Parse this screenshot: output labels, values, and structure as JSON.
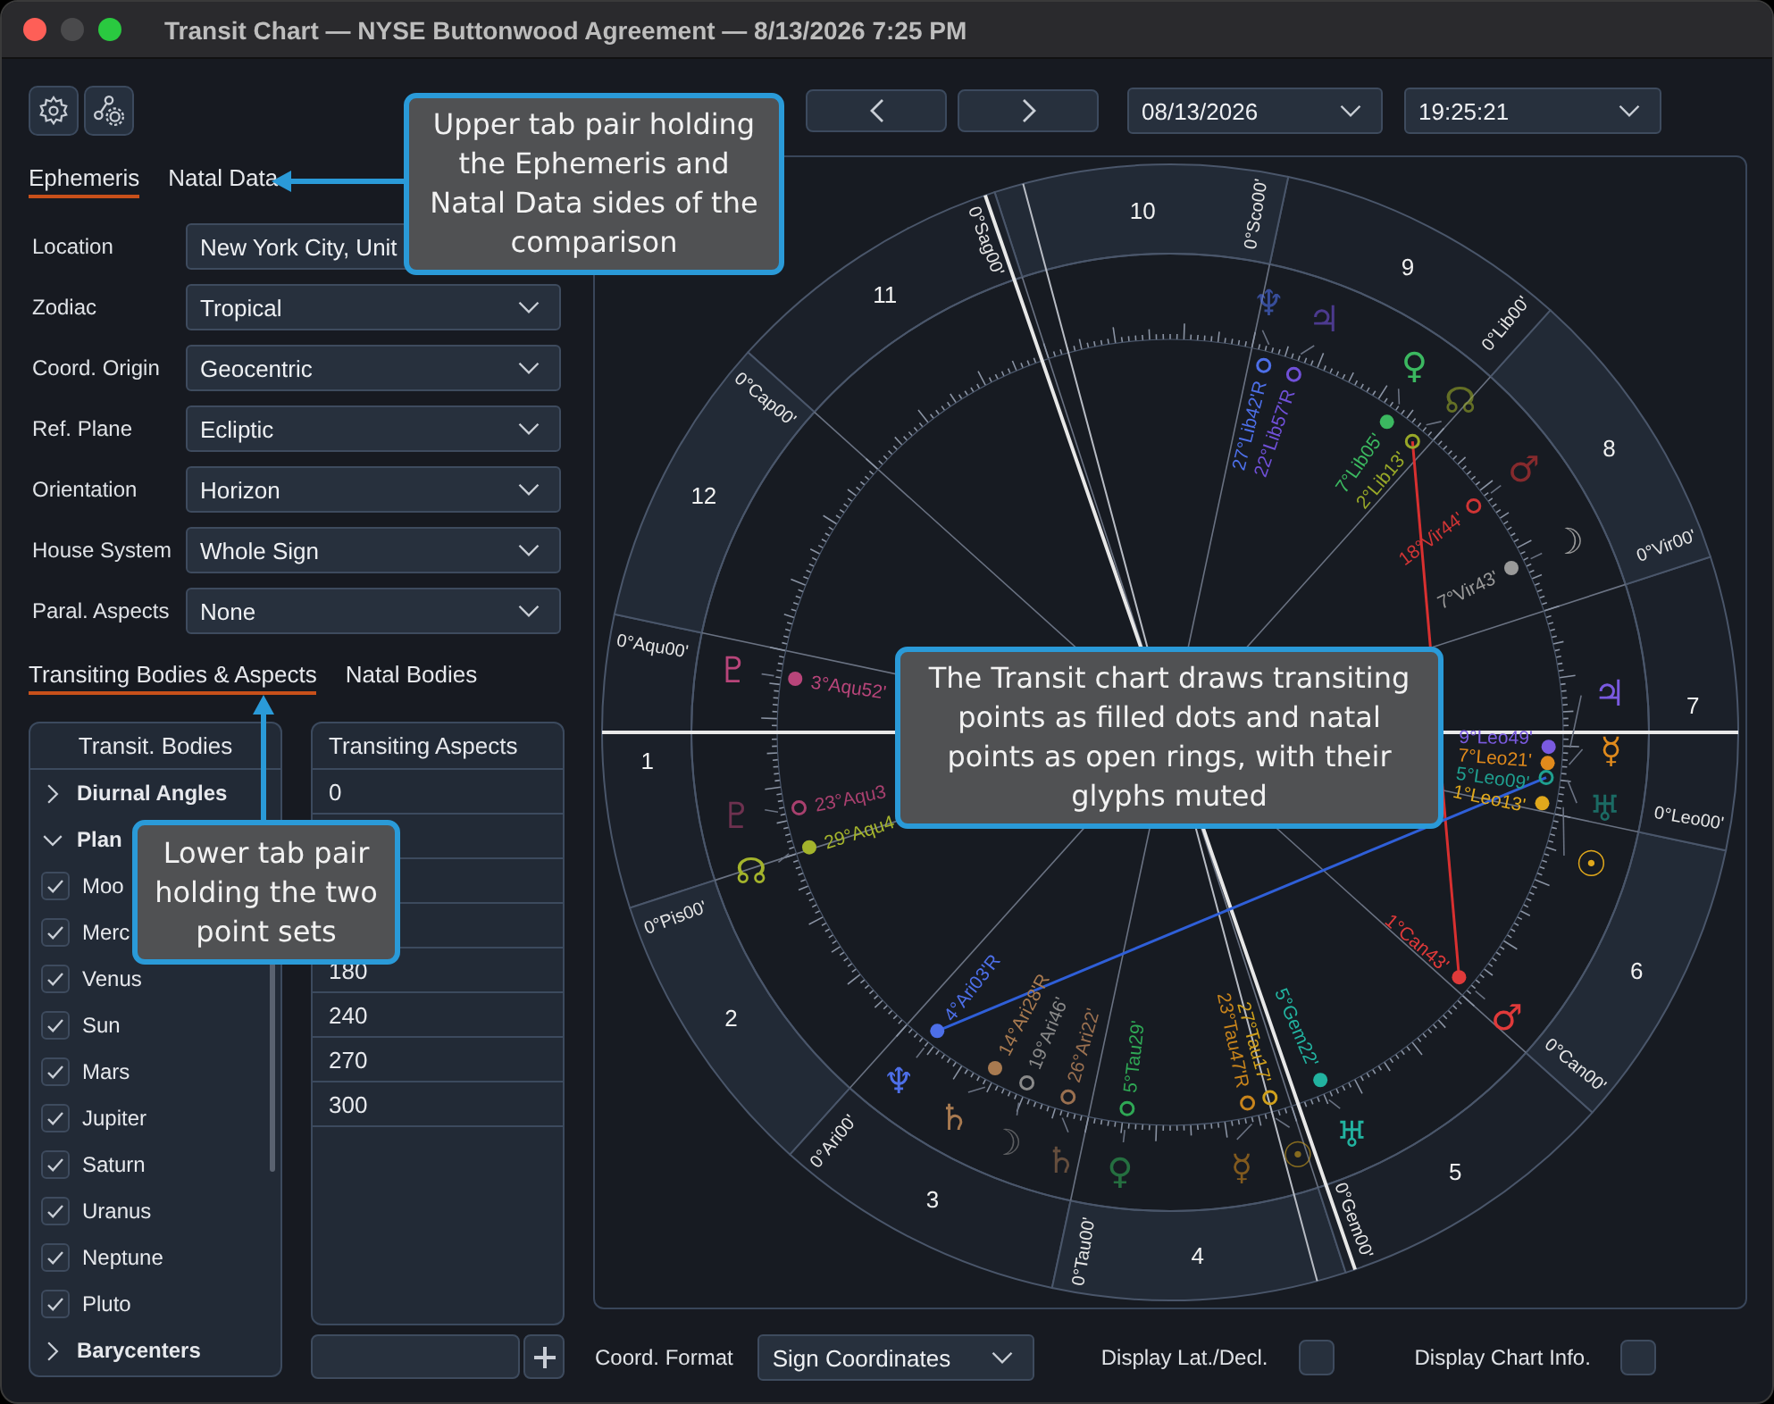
{
  "window": {
    "title": "Transit Chart — NYSE Buttonwood Agreement — 8/13/2026 7:25 PM"
  },
  "toolbar": {
    "date": "08/13/2026",
    "time": "19:25:21"
  },
  "upper_tabs": [
    {
      "label": "Ephemeris",
      "selected": true
    },
    {
      "label": "Natal Data",
      "selected": false
    }
  ],
  "fields": [
    {
      "label": "Location",
      "value": "New York City, Unit",
      "kind": "text"
    },
    {
      "label": "Zodiac",
      "value": "Tropical",
      "kind": "select"
    },
    {
      "label": "Coord. Origin",
      "value": "Geocentric",
      "kind": "select"
    },
    {
      "label": "Ref. Plane",
      "value": "Ecliptic",
      "kind": "select"
    },
    {
      "label": "Orientation",
      "value": "Horizon",
      "kind": "select"
    },
    {
      "label": "House System",
      "value": "Whole Sign",
      "kind": "select"
    },
    {
      "label": "Paral. Aspects",
      "value": "None",
      "kind": "select"
    }
  ],
  "lower_tabs": [
    {
      "label": "Transiting Bodies & Aspects",
      "selected": true
    },
    {
      "label": "Natal Bodies",
      "selected": false
    }
  ],
  "bodies": {
    "header": "Transit. Bodies",
    "groups": [
      {
        "label": "Diurnal Angles",
        "expanded": false
      },
      {
        "label": "Plan",
        "expanded": true,
        "children": [
          {
            "label": "Moo",
            "checked": true
          },
          {
            "label": "Merc",
            "checked": true
          },
          {
            "label": "Venus",
            "checked": true
          },
          {
            "label": "Sun",
            "checked": true
          },
          {
            "label": "Mars",
            "checked": true
          },
          {
            "label": "Jupiter",
            "checked": true
          },
          {
            "label": "Saturn",
            "checked": true
          },
          {
            "label": "Uranus",
            "checked": true
          },
          {
            "label": "Neptune",
            "checked": true
          },
          {
            "label": "Pluto",
            "checked": true
          }
        ]
      },
      {
        "label": "Barycenters",
        "expanded": false
      }
    ]
  },
  "aspects": {
    "header": "Transiting Aspects",
    "rows": [
      "0",
      null,
      null,
      null,
      "180",
      "240",
      "270",
      "300"
    ]
  },
  "chart": {
    "houses": [
      {
        "number": "1",
        "cusp": "0°Aqu00'"
      },
      {
        "number": "2",
        "cusp": "0°Pis00'"
      },
      {
        "number": "3",
        "cusp": "0°Ari00'"
      },
      {
        "number": "4",
        "cusp": "0°Tau00'"
      },
      {
        "number": "5",
        "cusp": "0°Gem00'"
      },
      {
        "number": "6",
        "cusp": "0°Can00'"
      },
      {
        "number": "7",
        "cusp": "0°Leo00'"
      },
      {
        "number": "8",
        "cusp": "0°Vir00'"
      },
      {
        "number": "9",
        "cusp": "0°Lib00'"
      },
      {
        "number": "10",
        "cusp": "0°Sco00'"
      },
      {
        "number": "11",
        "cusp": "0°Sag00'"
      },
      {
        "number": "12",
        "cusp": "0°Cap00'"
      }
    ],
    "points": [
      {
        "label": "3°Aqu52'",
        "glyph": "♇",
        "kind": "transit",
        "color": "#b8457a"
      },
      {
        "label": "23°Aqu3",
        "glyph": "♇",
        "kind": "natal",
        "color": "#a8406e"
      },
      {
        "label": "29°Aqu4",
        "glyph": "☊",
        "kind": "transit",
        "color": "#a4b42c"
      },
      {
        "label": "4°Ari03'R",
        "glyph": "♆",
        "kind": "transit",
        "color": "#4d6fe8"
      },
      {
        "label": "14°Ari28'R",
        "glyph": "♄",
        "kind": "transit",
        "color": "#a87a50"
      },
      {
        "label": "19°Ari46'",
        "glyph": "☽",
        "kind": "natal",
        "color": "#8a8a8a"
      },
      {
        "label": "26°Ari22'",
        "glyph": "♄",
        "kind": "natal",
        "color": "#9a7050"
      },
      {
        "label": "5°Tau29'",
        "glyph": "♀",
        "kind": "natal",
        "color": "#2fa855"
      },
      {
        "label": "23°Tau47'R",
        "glyph": "☿",
        "kind": "natal",
        "color": "#c8841c"
      },
      {
        "label": "27°Tau17'",
        "glyph": "☉",
        "kind": "natal",
        "color": "#d0a01c"
      },
      {
        "label": "5°Gem22'",
        "glyph": "♅",
        "kind": "transit",
        "color": "#22b3a0"
      },
      {
        "label": "1°Can43'",
        "glyph": "♂",
        "kind": "transit",
        "color": "#e03a3a"
      },
      {
        "label": "9°Leo49'",
        "glyph": "♃",
        "kind": "transit",
        "color": "#7a5ae0"
      },
      {
        "label": "7°Leo21'",
        "glyph": "☿",
        "kind": "transit",
        "color": "#e08a1c"
      },
      {
        "label": "5°Leo09'",
        "glyph": "♅",
        "kind": "natal",
        "color": "#1fa090"
      },
      {
        "label": "1°Leo13'",
        "glyph": "☉",
        "kind": "transit",
        "color": "#e0a81c"
      },
      {
        "label": "7°Vir43'",
        "glyph": "☽",
        "kind": "transit",
        "color": "#9a9a9a"
      },
      {
        "label": "18°Vir44'",
        "glyph": "♂",
        "kind": "natal",
        "color": "#d03535"
      },
      {
        "label": "2°Lib13'",
        "glyph": "☊",
        "kind": "natal",
        "color": "#98a828"
      },
      {
        "label": "7°Lib05'",
        "glyph": "♀",
        "kind": "transit",
        "color": "#3bb860"
      },
      {
        "label": "22°Lib57'R",
        "glyph": "♃",
        "kind": "natal",
        "color": "#7050d8"
      },
      {
        "label": "27°Lib42'R",
        "glyph": "♆",
        "kind": "natal",
        "color": "#4d6fe8"
      }
    ]
  },
  "footer": {
    "format_label": "Coord. Format",
    "format_value": "Sign Coordinates",
    "options": [
      {
        "label": "Display Lat./Decl.",
        "checked": false
      },
      {
        "label": "Display Chart Info.",
        "checked": false
      }
    ]
  },
  "callouts": [
    {
      "text": "Upper tab pair holding the Ephemeris and Natal Data sides of the comparison",
      "kind": "left"
    },
    {
      "text": "Lower tab pair holding the two point sets",
      "kind": "up"
    },
    {
      "text": "The Transit chart draws transiting points as filled dots and natal points as open rings, with their glyphs muted",
      "kind": "plain"
    }
  ]
}
